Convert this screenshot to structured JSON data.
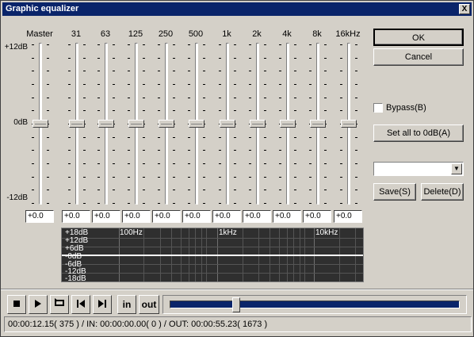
{
  "window": {
    "title": "Graphic equalizer",
    "close_label": "X"
  },
  "db_labels": {
    "top": "+12dB",
    "mid": "0dB",
    "bottom": "-12dB"
  },
  "bands": [
    {
      "label": "Master",
      "value": "+0.0"
    },
    {
      "label": "31",
      "value": "+0.0"
    },
    {
      "label": "63",
      "value": "+0.0"
    },
    {
      "label": "125",
      "value": "+0.0"
    },
    {
      "label": "250",
      "value": "+0.0"
    },
    {
      "label": "500",
      "value": "+0.0"
    },
    {
      "label": "1k",
      "value": "+0.0"
    },
    {
      "label": "2k",
      "value": "+0.0"
    },
    {
      "label": "4k",
      "value": "+0.0"
    },
    {
      "label": "8k",
      "value": "+0.0"
    },
    {
      "label": "16kHz",
      "value": "+0.0"
    }
  ],
  "buttons": {
    "ok": "OK",
    "cancel": "Cancel",
    "bypass": "Bypass(B)",
    "set_all": "Set all to 0dB(A)",
    "save": "Save(S)",
    "delete": "Delete(D)"
  },
  "preset": {
    "value": ""
  },
  "graph": {
    "y_labels": [
      "+18dB",
      "+12dB",
      "+6dB",
      "-0dB",
      "-6dB",
      "-12dB",
      "-18dB"
    ],
    "x_labels": [
      "100Hz",
      "1kHz",
      "10kHz"
    ]
  },
  "transport": {
    "stop_icon": "stop-icon",
    "play_icon": "play-icon",
    "loop_icon": "loop-icon",
    "prev_icon": "step-back-icon",
    "next_icon": "step-forward-icon",
    "in_label": "in",
    "out_label": "out",
    "seek_fraction": 0.23
  },
  "status": {
    "text": "00:00:12.15( 375 ) / IN: 00:00:00.00( 0 ) / OUT: 00:00:55.23( 1673 )"
  },
  "colors": {
    "titlebar": "#0a246a",
    "face": "#d4d0c8",
    "graph_bg": "#2f2f2f"
  }
}
